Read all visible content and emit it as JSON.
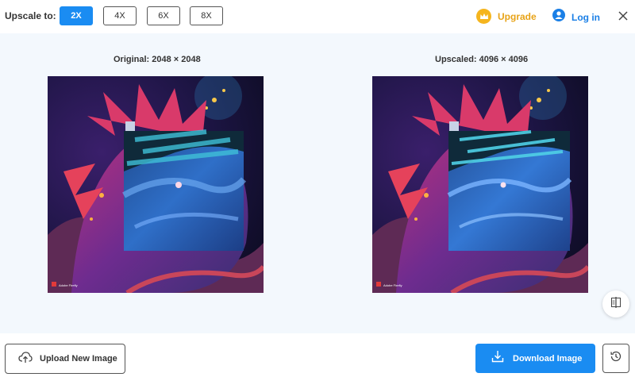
{
  "toolbar": {
    "upscale_label": "Upscale to:",
    "scale_options": [
      "2X",
      "4X",
      "6X",
      "8X"
    ],
    "selected_scale": "2X",
    "upgrade_label": "Upgrade",
    "login_label": "Log in"
  },
  "preview": {
    "original_caption": "Original: 2048 × 2048",
    "upscaled_caption": "Upscaled: 4096 × 4096",
    "watermark": "Adobe Firefly"
  },
  "actions": {
    "upload_label": "Upload New Image",
    "download_label": "Download Image"
  },
  "icons": {
    "upgrade": "crown-icon",
    "login": "user-icon",
    "close": "close-icon",
    "compare": "compare-icon",
    "upload": "cloud-upload-icon",
    "download": "download-icon",
    "history": "history-icon"
  },
  "colors": {
    "accent": "#1a8cf2",
    "upgrade": "#e8a317",
    "background": "#f3f8fd"
  }
}
